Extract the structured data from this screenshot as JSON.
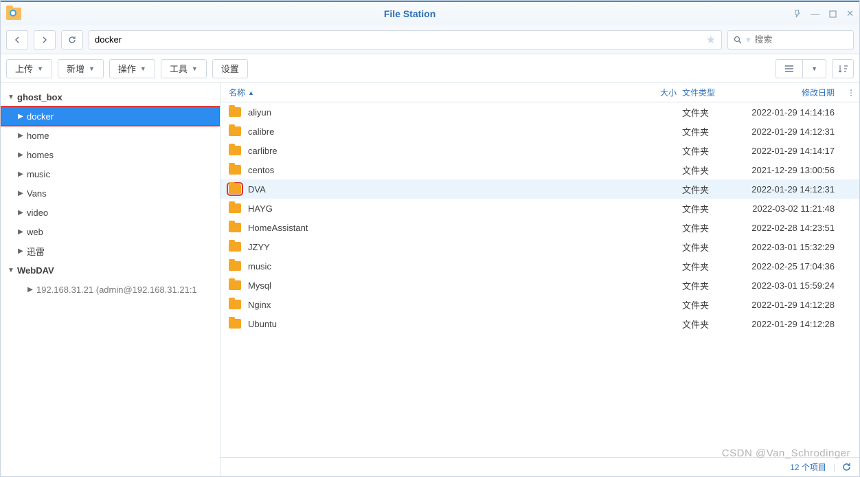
{
  "window": {
    "title": "File Station",
    "controls": {
      "pin": "⇱",
      "min": "—",
      "max": "▢",
      "close": "✕"
    }
  },
  "nav": {
    "path_value": "docker",
    "search_placeholder": "搜索"
  },
  "toolbar": {
    "upload": "上传",
    "new": "新增",
    "action": "操作",
    "tools": "工具",
    "settings": "设置"
  },
  "tree": {
    "roots": [
      {
        "label": "ghost_box",
        "expanded": true,
        "children": [
          {
            "label": "docker",
            "selected": true,
            "redbox": true
          },
          {
            "label": "home"
          },
          {
            "label": "homes"
          },
          {
            "label": "music"
          },
          {
            "label": "Vans"
          },
          {
            "label": "video"
          },
          {
            "label": "web"
          },
          {
            "label": "迅雷"
          }
        ]
      },
      {
        "label": "WebDAV",
        "expanded": true,
        "children": [
          {
            "label": "192.168.31.21 (admin@192.168.31.21:1",
            "leaf_dim": true
          }
        ]
      }
    ]
  },
  "columns": {
    "name": "名称",
    "size": "大小",
    "type": "文件类型",
    "date": "修改日期"
  },
  "files": [
    {
      "name": "aliyun",
      "type": "文件夹",
      "date": "2022-01-29 14:14:16"
    },
    {
      "name": "calibre",
      "type": "文件夹",
      "date": "2022-01-29 14:12:31"
    },
    {
      "name": "carlibre",
      "type": "文件夹",
      "date": "2022-01-29 14:14:17"
    },
    {
      "name": "centos",
      "type": "文件夹",
      "date": "2021-12-29 13:00:56"
    },
    {
      "name": "DVA",
      "type": "文件夹",
      "date": "2022-01-29 14:12:31",
      "selected": true,
      "redbox": true
    },
    {
      "name": "HAYG",
      "type": "文件夹",
      "date": "2022-03-02 11:21:48"
    },
    {
      "name": "HomeAssistant",
      "type": "文件夹",
      "date": "2022-02-28 14:23:51"
    },
    {
      "name": "JZYY",
      "type": "文件夹",
      "date": "2022-03-01 15:32:29"
    },
    {
      "name": "music",
      "type": "文件夹",
      "date": "2022-02-25 17:04:36"
    },
    {
      "name": "Mysql",
      "type": "文件夹",
      "date": "2022-03-01 15:59:24"
    },
    {
      "name": "Nginx",
      "type": "文件夹",
      "date": "2022-01-29 14:12:28"
    },
    {
      "name": "Ubuntu",
      "type": "文件夹",
      "date": "2022-01-29 14:12:28"
    }
  ],
  "status": {
    "count_text": "12 个项目",
    "reload_icon": "↻"
  },
  "watermark": "CSDN @Van_Schrodinger"
}
